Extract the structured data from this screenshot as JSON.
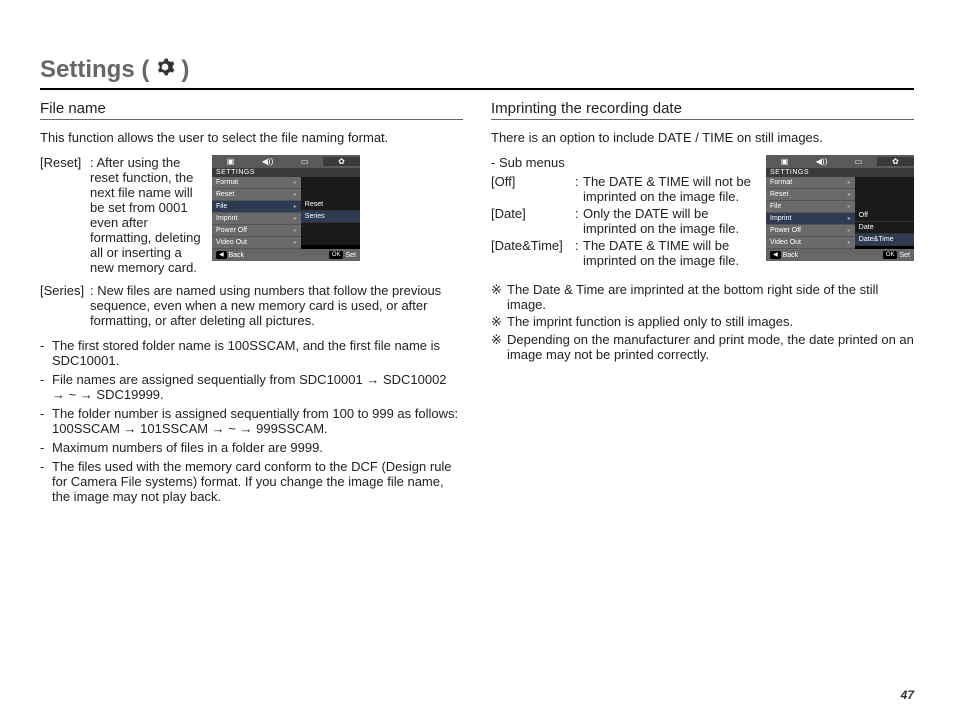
{
  "page_number": "47",
  "title_prefix": "Settings (",
  "title_suffix": ")",
  "left": {
    "heading": "File name",
    "intro": "This function allows the user to select the file naming format.",
    "defs": [
      {
        "label": "[Reset]",
        "text": ": After using the reset function, the next file name will be set from 0001 even after formatting, deleting all or inserting a new memory card."
      },
      {
        "label": "[Series]",
        "text": ": New files are named using numbers that follow the previous sequence, even when a new memory card is used, or after formatting, or after deleting all pictures."
      }
    ],
    "bullets": [
      "The first stored folder name is 100SSCAM, and the first file name is SDC10001.",
      "File names are assigned sequentially from SDC10001 → SDC10002 → ~ → SDC19999.",
      "The folder number is assigned sequentially from 100 to 999 as follows: 100SSCAM → 101SSCAM → ~ → 999SSCAM.",
      "Maximum numbers of files in a folder are 9999.",
      "The files used with the memory card conform to the DCF (Design rule for Camera File systems) format. If you change the image file name, the image may not play back."
    ],
    "menu": {
      "header": "SETTINGS",
      "items": [
        "Format",
        "Reset",
        "File",
        "Imprint",
        "Power Off",
        "Video Out"
      ],
      "selected_index": 2,
      "sub_items": [
        "Reset",
        "Series"
      ],
      "sub_selected_index": 1,
      "back": "Back",
      "ok": "OK",
      "set": "Set"
    }
  },
  "right": {
    "heading": "Imprinting the recording date",
    "intro": "There is an option to include DATE / TIME on still images.",
    "sub_head": "- Sub menus",
    "subs": [
      {
        "label": "[Off]",
        "text": "The DATE & TIME will not be imprinted on the image file."
      },
      {
        "label": "[Date]",
        "text": "Only the DATE will be imprinted on the image file."
      },
      {
        "label": "[Date&Time]",
        "text": "The DATE & TIME will be imprinted on the image file."
      }
    ],
    "notes": [
      "The Date & Time are imprinted at the bottom right side of the still image.",
      "The imprint function is applied only to still images.",
      "Depending on the manufacturer and print mode, the date printed on an image may not be printed correctly."
    ],
    "menu": {
      "header": "SETTINGS",
      "items": [
        "Format",
        "Reset",
        "File",
        "Imprint",
        "Power Off",
        "Video Out"
      ],
      "selected_index": 3,
      "sub_items": [
        "Off",
        "Date",
        "Date&Time"
      ],
      "sub_selected_index": 2,
      "back": "Back",
      "ok": "OK",
      "set": "Set"
    }
  },
  "icons": {
    "tab_camera": "camera-icon",
    "tab_sound": "sound-icon",
    "tab_display": "display-icon",
    "tab_settings": "gear-icon"
  }
}
